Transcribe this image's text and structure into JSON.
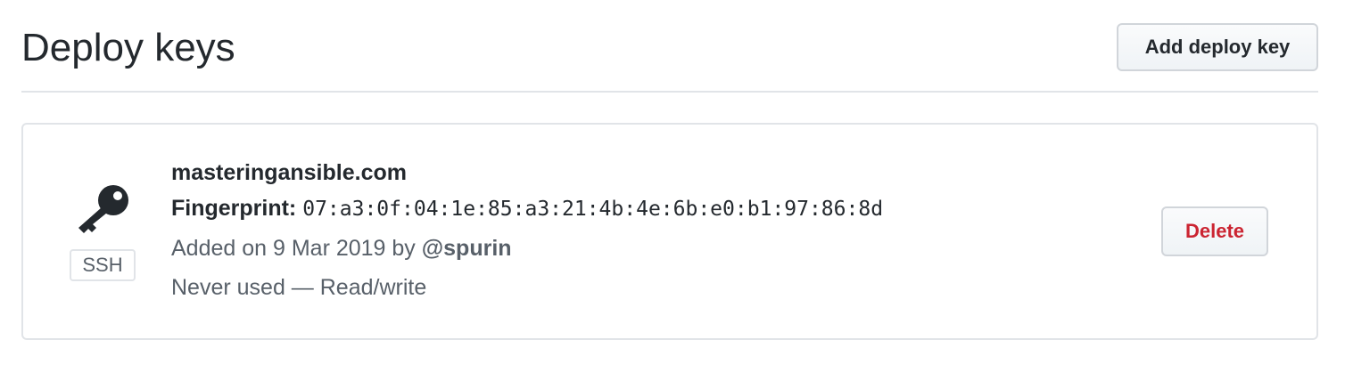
{
  "header": {
    "title": "Deploy keys",
    "add_button_label": "Add deploy key"
  },
  "keys": [
    {
      "icon": "key-icon",
      "type_label": "SSH",
      "title": "masteringansible.com",
      "fingerprint_label": "Fingerprint:",
      "fingerprint": "07:a3:0f:04:1e:85:a3:21:4b:4e:6b:e0:b1:97:86:8d",
      "added_text": "Added on 9 Mar 2019 by",
      "added_by": "@spurin",
      "usage": "Never used — Read/write",
      "delete_label": "Delete"
    }
  ],
  "colors": {
    "text": "#24292e",
    "muted": "#586069",
    "border": "#e1e4e8",
    "danger": "#cb2431"
  }
}
